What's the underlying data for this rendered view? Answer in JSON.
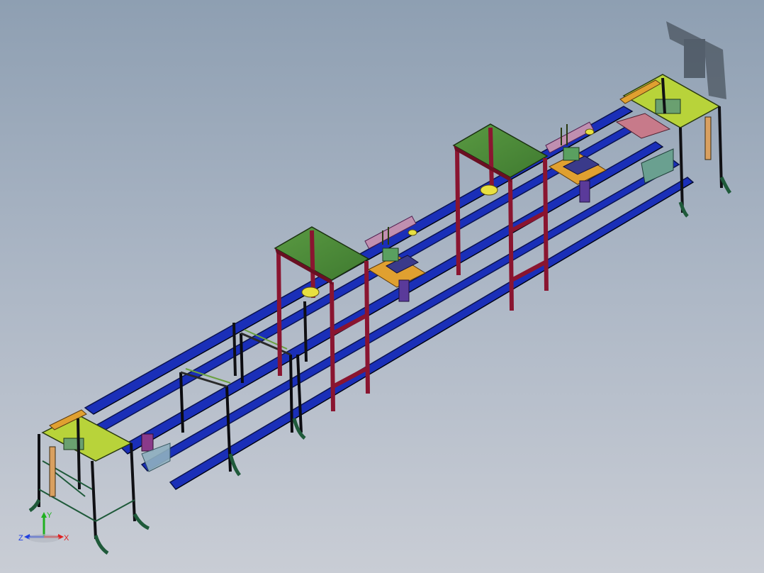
{
  "view": {
    "background_top": "#8e9fb2",
    "background_bottom": "#c9cdd5"
  },
  "colors": {
    "rail_blue": "#1a2fb8",
    "rail_dark": "#0b1450",
    "frame_black": "#101014",
    "table_top_green": "#4f8a3a",
    "table_leg_maroon": "#8a1530",
    "station_yellow_green": "#b8d33a",
    "bracket_orange": "#e0a030",
    "cylinder_yellow": "#e8e040",
    "motor_purple": "#3a3a8a",
    "foot_green": "#1f5a3a",
    "tube_pink": "#c08fb0"
  },
  "triad": {
    "x_label": "X",
    "y_label": "Y",
    "z_label": "Z",
    "x_color": "#e02020",
    "y_color": "#20b020",
    "z_color": "#2040e0"
  }
}
